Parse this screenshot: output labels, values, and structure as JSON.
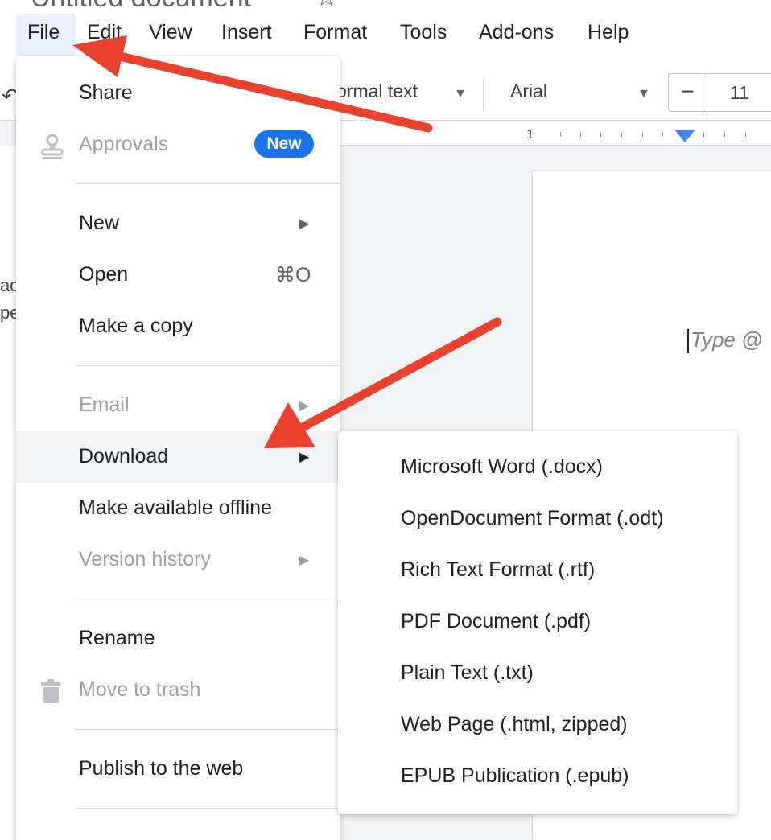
{
  "window": {
    "title": "Untitled document"
  },
  "menubar": [
    "File",
    "Edit",
    "View",
    "Insert",
    "Format",
    "Tools",
    "Add-ons",
    "Help"
  ],
  "toolbar": {
    "style": "ormal text",
    "font": "Arial",
    "font_size": "11",
    "minus": "−"
  },
  "ruler": {
    "number": "1"
  },
  "outline_fragments": [
    "ad",
    "pe"
  ],
  "document": {
    "placeholder": "Type @"
  },
  "file_menu": {
    "share": "Share",
    "approvals": "Approvals",
    "new_badge": "New",
    "new": "New",
    "open": "Open",
    "open_shortcut": "⌘O",
    "make_copy": "Make a copy",
    "email": "Email",
    "download": "Download",
    "offline": "Make available offline",
    "version_history": "Version history",
    "rename": "Rename",
    "trash": "Move to trash",
    "publish": "Publish to the web"
  },
  "download_submenu": [
    "Microsoft Word (.docx)",
    "OpenDocument Format (.odt)",
    "Rich Text Format (.rtf)",
    "PDF Document (.pdf)",
    "Plain Text (.txt)",
    "Web Page (.html, zipped)",
    "EPUB Publication (.epub)"
  ],
  "icons": {
    "star": "star-icon",
    "undo": "undo-icon",
    "approvals": "stamp-icon",
    "trash": "trash-icon",
    "submenu_arrow": "triangle-right-icon",
    "caret": "caret-down-icon"
  },
  "colors": {
    "accent": "#1a73e8",
    "annotation_arrow": "#e8422d",
    "hover": "#f1f3f4"
  }
}
